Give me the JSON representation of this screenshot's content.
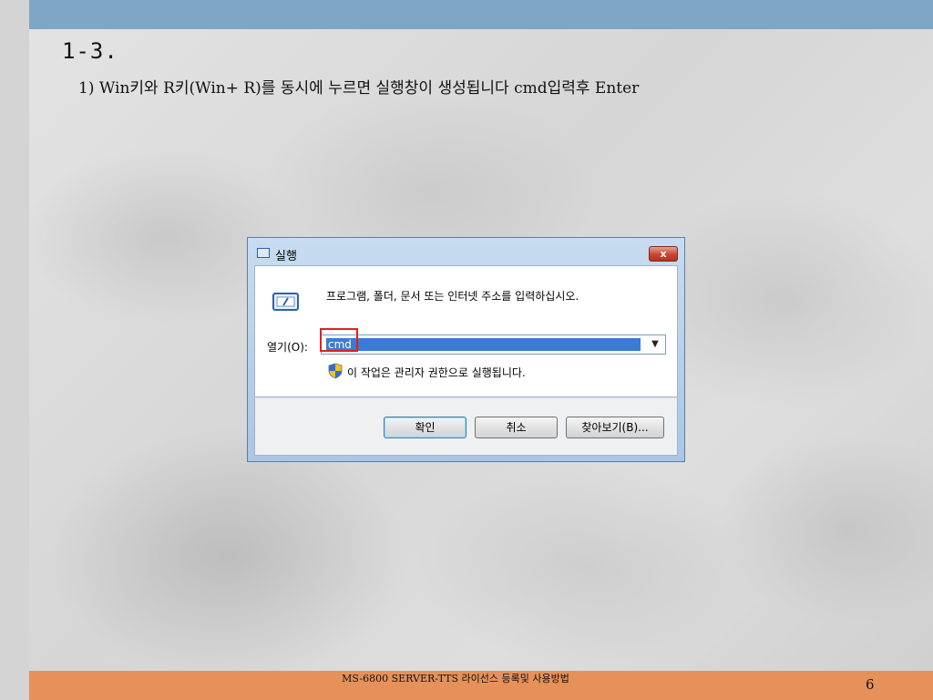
{
  "slide": {
    "title": "1-3.",
    "subtitle": "1) Win키와 R키(Win+ R)를 동시에 누르면 실행창이 생성됩니다 cmd입력후 Enter",
    "footer_text": "MS-6800 SERVER-TTS 라이선스 등록및 사용방법",
    "page_number": "6",
    "colors": {
      "top_bar": "#7fa6c4",
      "footer_bar": "#e6915a",
      "highlight": "#e02020"
    }
  },
  "run_dialog": {
    "title": "실행",
    "title_icon": "run-window-icon",
    "close_label": "x",
    "prompt": "프로그램, 폴더, 문서 또는 인터넷 주소를 입력하십시오.",
    "open_label": "열기(O):",
    "input_value": "cmd",
    "dropdown_icon": "chevron-down-icon",
    "admin_icon": "uac-shield-icon",
    "admin_notice": "이 작업은 관리자 권한으로 실행됩니다.",
    "buttons": {
      "ok": "확인",
      "cancel": "취소",
      "browse": "찾아보기(B)..."
    }
  }
}
